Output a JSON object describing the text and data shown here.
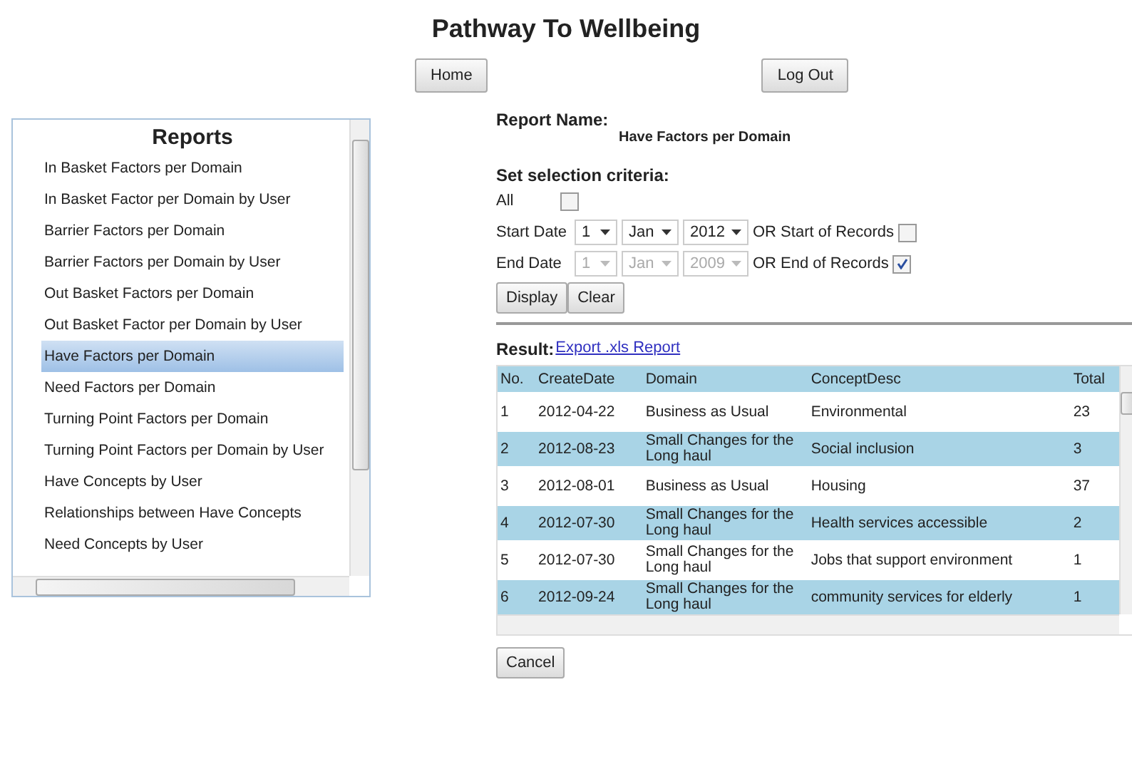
{
  "title": "Pathway To Wellbeing",
  "nav_buttons": [
    "Home",
    "Log Out"
  ],
  "reports": {
    "heading": "Reports",
    "items": [
      {
        "label": "In Basket Factors per Domain",
        "selected": false
      },
      {
        "label": "In Basket Factor per Domain by User",
        "selected": false
      },
      {
        "label": "Barrier Factors per Domain",
        "selected": false
      },
      {
        "label": "Barrier Factors per Domain by User",
        "selected": false
      },
      {
        "label": "Out Basket Factors per Domain",
        "selected": false
      },
      {
        "label": "Out Basket Factor per Domain by User",
        "selected": false
      },
      {
        "label": "Have Factors per Domain",
        "selected": true
      },
      {
        "label": "Need Factors per Domain",
        "selected": false
      },
      {
        "label": "Turning Point Factors per Domain",
        "selected": false
      },
      {
        "label": "Turning Point Factors per Domain by User",
        "selected": false
      },
      {
        "label": "Have Concepts by User",
        "selected": false
      },
      {
        "label": "Relationships between Have Concepts",
        "selected": false
      },
      {
        "label": "Need Concepts by User",
        "selected": false
      }
    ]
  },
  "report_name": {
    "label": "Report Name:",
    "value": "Have Factors per Domain"
  },
  "criteria": {
    "heading": "Set selection criteria:",
    "all": {
      "label": "All",
      "checked": false
    },
    "dates": [
      {
        "label": "Start Date",
        "day": "1",
        "month": "Jan",
        "year": "2012",
        "disabled": false,
        "or_label": "OR Start of Records",
        "checked": false
      },
      {
        "label": "End Date",
        "day": "1",
        "month": "Jan",
        "year": "2009",
        "disabled": true,
        "or_label": "OR End of Records",
        "checked": true
      }
    ],
    "buttons": [
      "Display",
      "Clear"
    ]
  },
  "result": {
    "label": "Result:",
    "link": "Export .xls Report",
    "columns": [
      "No.",
      "CreateDate",
      "Domain",
      "ConceptDesc",
      "Total"
    ],
    "rows": [
      [
        "1",
        "2012-04-22",
        "Business as Usual",
        "Environmental",
        "23"
      ],
      [
        "2",
        "2012-08-23",
        "Small Changes for the Long haul",
        "Social inclusion",
        "3"
      ],
      [
        "3",
        "2012-08-01",
        "Business as Usual",
        "Housing",
        "37"
      ],
      [
        "4",
        "2012-07-30",
        "Small Changes for the Long haul",
        "Health services accessible",
        "2"
      ],
      [
        "5",
        "2012-07-30",
        "Small Changes for the Long haul",
        "Jobs that support environment",
        "1"
      ],
      [
        "6",
        "2012-09-24",
        "Small Changes for the Long haul",
        "community services for elderly",
        "1"
      ]
    ]
  },
  "cancel": "Cancel"
}
